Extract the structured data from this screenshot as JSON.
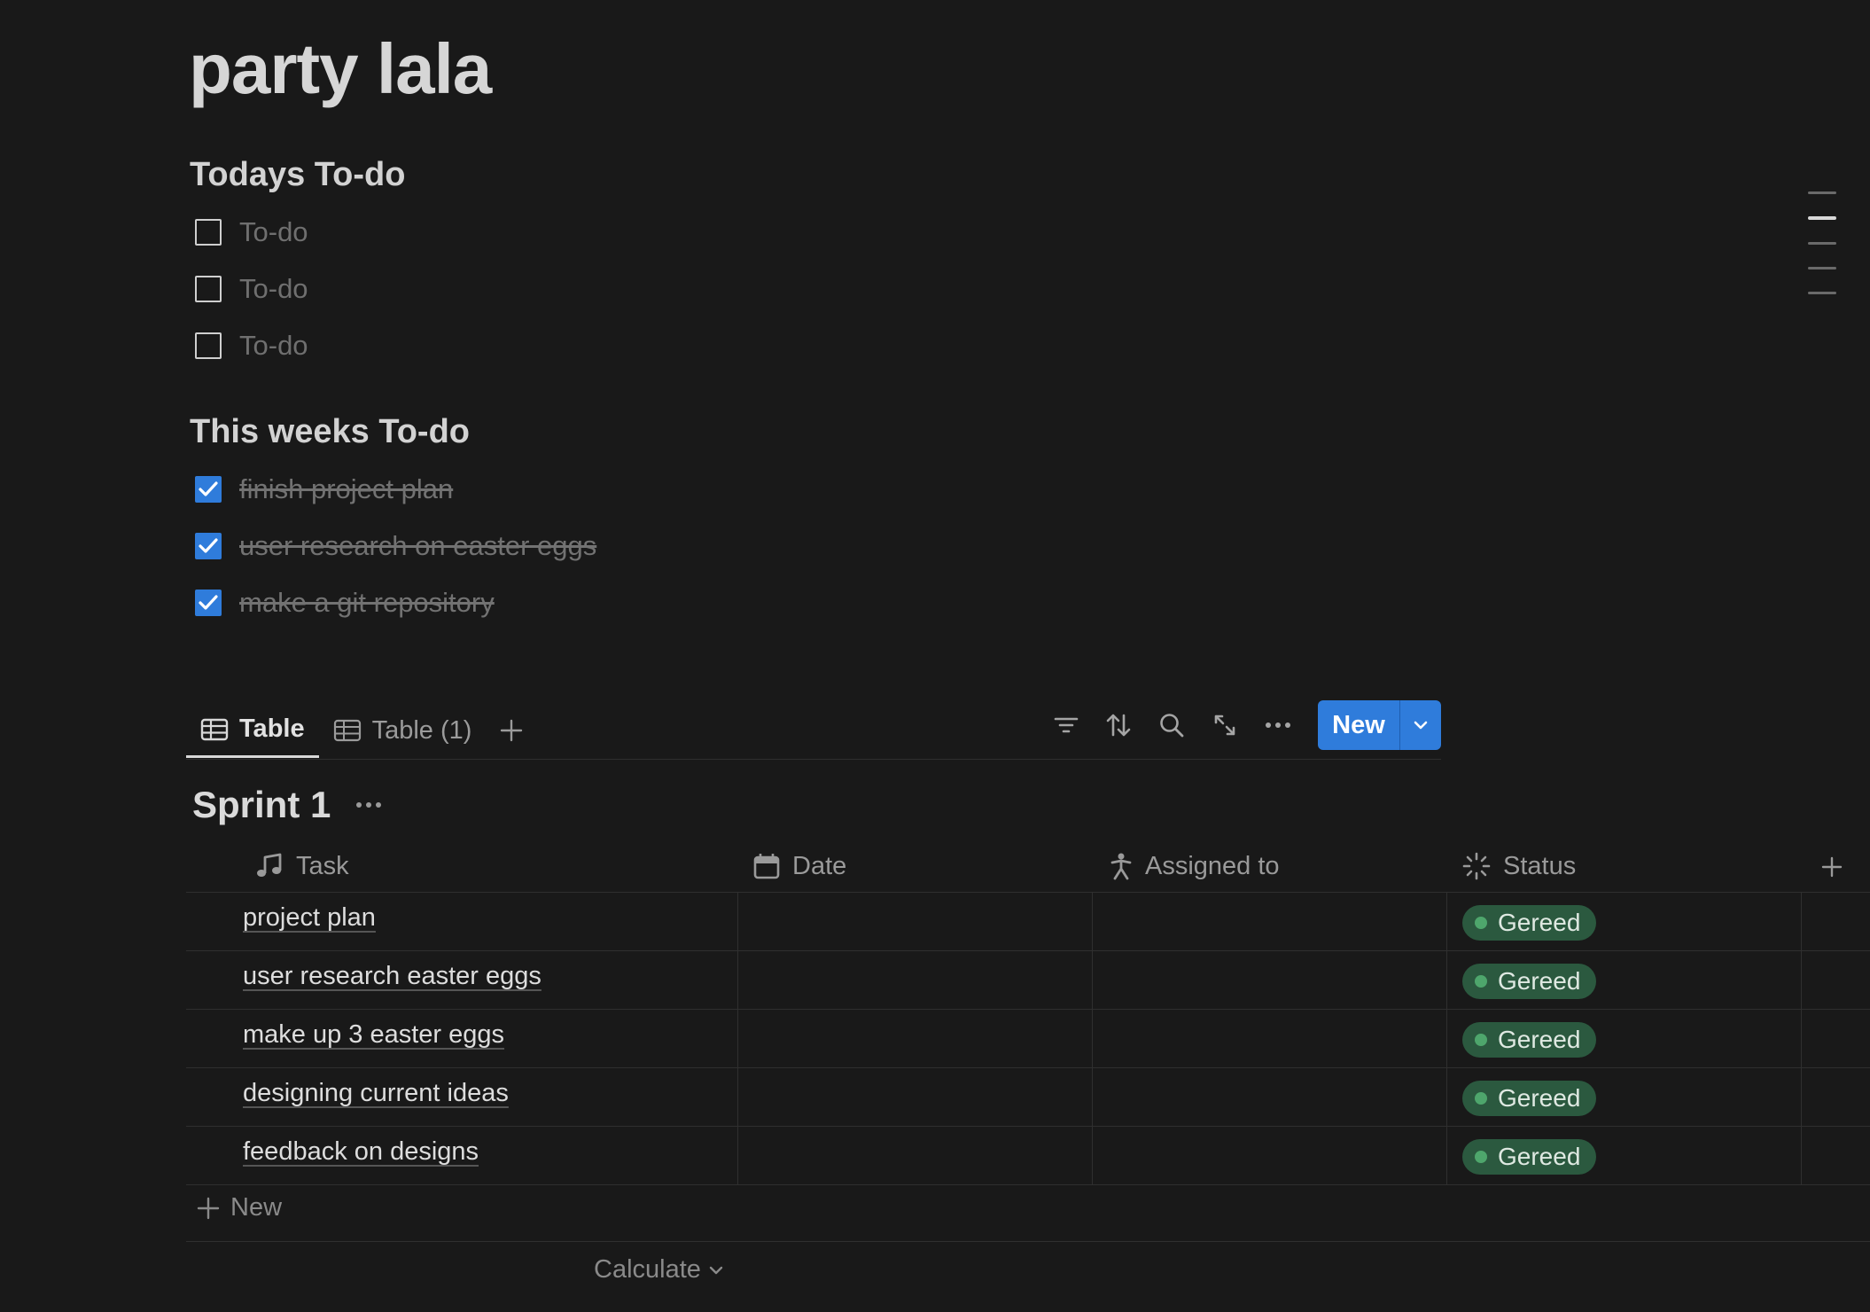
{
  "page": {
    "title": "party lala"
  },
  "todays": {
    "heading": "Todays To-do",
    "items": [
      {
        "label": "To-do",
        "checked": false
      },
      {
        "label": "To-do",
        "checked": false
      },
      {
        "label": "To-do",
        "checked": false
      }
    ]
  },
  "weeks": {
    "heading": "This weeks To-do",
    "items": [
      {
        "label": "finish project plan ",
        "checked": true
      },
      {
        "label": "user research on easter eggs",
        "checked": true
      },
      {
        "label": "make a git repository",
        "checked": true
      }
    ]
  },
  "views": {
    "tabs": [
      {
        "label": "Table",
        "icon": "table-icon",
        "active": true
      },
      {
        "label": "Table (1)",
        "icon": "table-icon",
        "active": false
      }
    ],
    "toolbar": {
      "icons": [
        "filter-icon",
        "sort-icon",
        "search-icon",
        "expand-icon",
        "more-icon"
      ],
      "new_label": "New"
    }
  },
  "database": {
    "title": "Sprint 1",
    "columns": [
      {
        "label": "Task",
        "icon": "music-note-icon"
      },
      {
        "label": "Date",
        "icon": "calendar-icon"
      },
      {
        "label": "Assigned to",
        "icon": "person-icon"
      },
      {
        "label": "Status",
        "icon": "status-icon"
      }
    ],
    "rows": [
      {
        "task": "project plan",
        "date": "",
        "assigned": "",
        "status": "Gereed"
      },
      {
        "task": "user research easter eggs",
        "date": "",
        "assigned": "",
        "status": "Gereed"
      },
      {
        "task": "make up 3 easter eggs",
        "date": "",
        "assigned": "",
        "status": "Gereed"
      },
      {
        "task": "designing current ideas",
        "date": "",
        "assigned": "",
        "status": "Gereed"
      },
      {
        "task": "feedback on designs",
        "date": "",
        "assigned": "",
        "status": "Gereed"
      }
    ],
    "add_row_label": "New",
    "calculate_label": "Calculate"
  },
  "colors": {
    "background": "#191919",
    "accent": "#2f7cdb",
    "status_done_bg": "#2b593f",
    "status_done_dot": "#4ea66c"
  }
}
